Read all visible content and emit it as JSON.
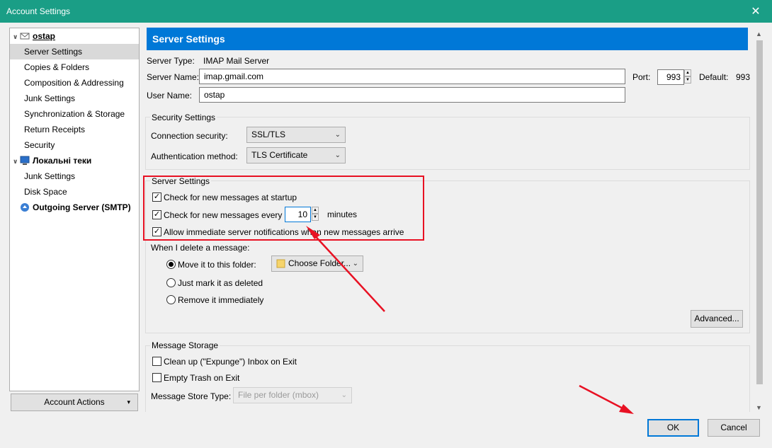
{
  "window": {
    "title": "Account Settings"
  },
  "tree": {
    "account": "ostap",
    "account_items": [
      "Server Settings",
      "Copies & Folders",
      "Composition & Addressing",
      "Junk Settings",
      "Synchronization & Storage",
      "Return Receipts",
      "Security"
    ],
    "local": "Локальні теки",
    "local_items": [
      "Junk Settings",
      "Disk Space"
    ],
    "outgoing": "Outgoing Server (SMTP)"
  },
  "account_actions": "Account Actions",
  "panel": {
    "title": "Server Settings",
    "server_type_label": "Server Type:",
    "server_type_value": "IMAP Mail Server",
    "server_name_label": "Server Name:",
    "server_name_value": "imap.gmail.com",
    "port_label": "Port:",
    "port_value": "993",
    "default_label": "Default:",
    "default_value": "993",
    "user_name_label": "User Name:",
    "user_name_value": "ostap"
  },
  "security": {
    "title": "Security Settings",
    "connection_label": "Connection security:",
    "connection_value": "SSL/TLS",
    "auth_label": "Authentication method:",
    "auth_value": "TLS Certificate"
  },
  "server_settings": {
    "title": "Server Settings",
    "check_startup": "Check for new messages at startup",
    "check_every": "Check for new messages every",
    "interval_value": "10",
    "minutes": "minutes",
    "allow_notifications": "Allow immediate server notifications when new messages arrive",
    "delete_label": "When I delete a message:",
    "move_to_folder": "Move it to this folder:",
    "choose_folder": "Choose Folder...",
    "just_mark": "Just mark it as deleted",
    "remove_immediately": "Remove it immediately",
    "advanced": "Advanced..."
  },
  "storage": {
    "title": "Message Storage",
    "clean_up": "Clean up (\"Expunge\") Inbox on Exit",
    "empty_trash": "Empty Trash on Exit",
    "store_type_label": "Message Store Type:",
    "store_type_value": "File per folder (mbox)"
  },
  "buttons": {
    "ok": "OK",
    "cancel": "Cancel"
  },
  "colors": {
    "titlebar": "#1a9e86",
    "header": "#0078d7",
    "annotation": "#e81123"
  }
}
